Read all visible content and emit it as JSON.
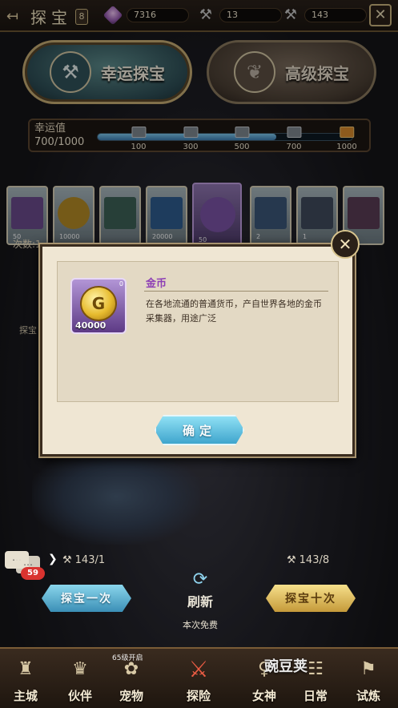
{
  "header": {
    "title": "探宝",
    "title_badge": "8",
    "resources": [
      {
        "icon": "gem-icon",
        "value": "7316"
      },
      {
        "icon": "pickaxe-icon",
        "value": "13"
      },
      {
        "icon": "pickaxe-icon",
        "value": "143"
      }
    ],
    "close_label": "✕"
  },
  "modes": {
    "lucky": {
      "label": "幸运探宝",
      "icon": "pickaxe-emblem-icon",
      "selected": true
    },
    "advanced": {
      "label": "高级探宝",
      "icon": "leaf-emblem-icon",
      "selected": false
    }
  },
  "luck": {
    "label": "幸运值",
    "value": "700/1000",
    "progress_fraction": 0.7,
    "milestones": [
      "100",
      "300",
      "500",
      "700",
      "1000"
    ]
  },
  "cards": [
    {
      "count": "50"
    },
    {
      "count": "10000"
    },
    {
      "count": ""
    },
    {
      "count": "20000"
    },
    {
      "count": "50"
    },
    {
      "count": "2"
    },
    {
      "count": "1"
    },
    {
      "count": ""
    }
  ],
  "remaining_label": "次数:1",
  "side_label": "探宝",
  "dialog": {
    "item_name": "金币",
    "item_qty": "40000",
    "item_corner": "0",
    "description": "在各地流通的普通货币，产自世界各地的金币采集器，用途广泛",
    "confirm_label": "确定"
  },
  "actions": {
    "chat_badge": "59",
    "once_cost": "143/1",
    "ten_cost": "143/8",
    "once_label": "探宝一次",
    "ten_label": "探宝十次",
    "refresh_label": "刷新",
    "free_label": "本次免费"
  },
  "nav": {
    "items": [
      {
        "label": "主城",
        "icon": "castle-icon"
      },
      {
        "label": "伙伴",
        "icon": "hat-icon"
      },
      {
        "label": "宠物",
        "icon": "paw-icon"
      },
      {
        "label": "探险",
        "icon": "crossed-swords-icon"
      },
      {
        "label": "女神",
        "icon": "goddess-icon"
      },
      {
        "label": "日常",
        "icon": "calendar-icon"
      },
      {
        "label": "试炼",
        "icon": "trial-icon"
      }
    ],
    "lock_note": "65级开启",
    "watermark": "豌豆荚"
  },
  "colors": {
    "accent_blue": "#3fa5cd",
    "accent_gold": "#c59a3a",
    "item_name_purple": "#8d3fb5",
    "badge_red": "#d9332f"
  }
}
